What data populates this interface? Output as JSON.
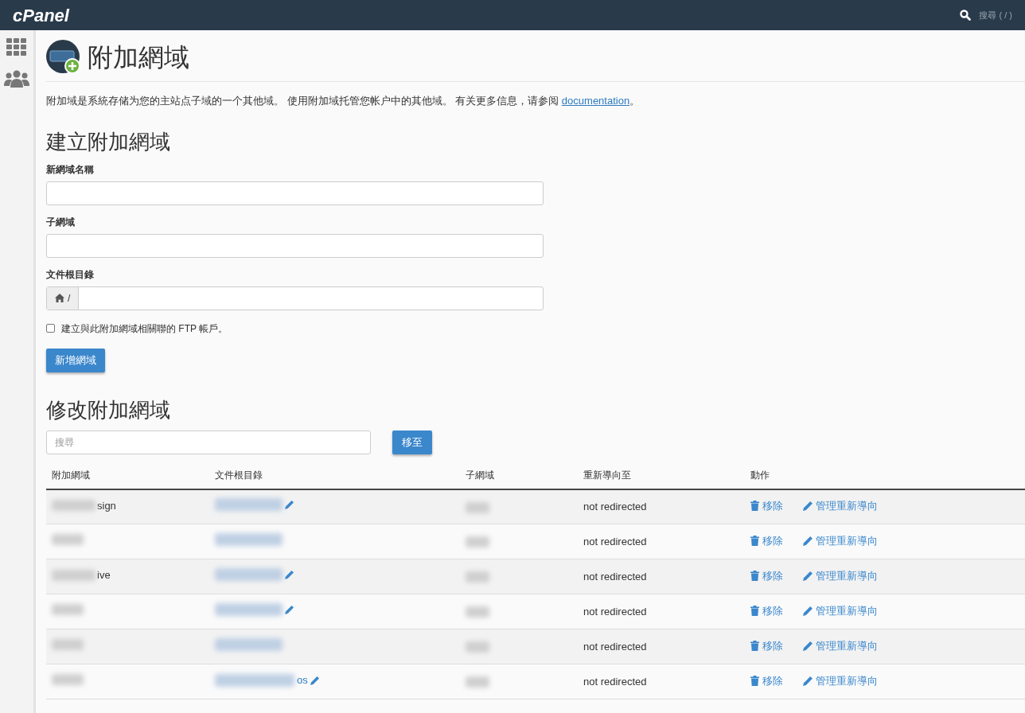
{
  "header": {
    "logo": "cPanel",
    "search_label": "搜尋 ( / )"
  },
  "page": {
    "title": "附加網域",
    "intro": "附加域是系統存储为您的主站点子域的一个其他域。 使用附加域托管您帐户中的其他域。 有关更多信息，请参阅",
    "intro_link": "documentation",
    "intro_end": "。"
  },
  "create": {
    "heading": "建立附加網域",
    "fields": [
      {
        "label": "新網域名稱",
        "kind": "text"
      },
      {
        "label": "子網域",
        "kind": "text"
      },
      {
        "label": "文件根目錄",
        "kind": "path",
        "prefix": "/"
      }
    ],
    "ftp_checkbox": {
      "label": "建立與此附加網域相關聯的 FTP 帳戶。",
      "checked": false
    },
    "submit": "新增網域"
  },
  "modify": {
    "heading": "修改附加網域",
    "search": {
      "placeholder": "搜尋"
    },
    "go_button": "移至",
    "table": {
      "columns": [
        "附加網域",
        "文件根目錄",
        "子網域",
        "重新導向至",
        "動作"
      ],
      "rows": [
        {
          "domain": "sign",
          "docroot": "",
          "editable": true,
          "redirect": "not redirected",
          "remove": "移除",
          "manage": "管理重新導向"
        },
        {
          "domain": "",
          "docroot": "",
          "editable": false,
          "redirect": "not redirected",
          "remove": "移除",
          "manage": "管理重新導向"
        },
        {
          "domain": "ive",
          "docroot": "",
          "editable": true,
          "redirect": "not redirected",
          "remove": "移除",
          "manage": "管理重新導向"
        },
        {
          "domain": "",
          "docroot": "",
          "editable": true,
          "redirect": "not redirected",
          "remove": "移除",
          "manage": "管理重新導向"
        },
        {
          "domain": "",
          "docroot": "",
          "editable": false,
          "redirect": "not redirected",
          "remove": "移除",
          "manage": "管理重新導向"
        },
        {
          "domain": "",
          "docroot": "os",
          "editable": true,
          "redirect": "not redirected",
          "remove": "移除",
          "manage": "管理重新導向"
        }
      ]
    }
  }
}
